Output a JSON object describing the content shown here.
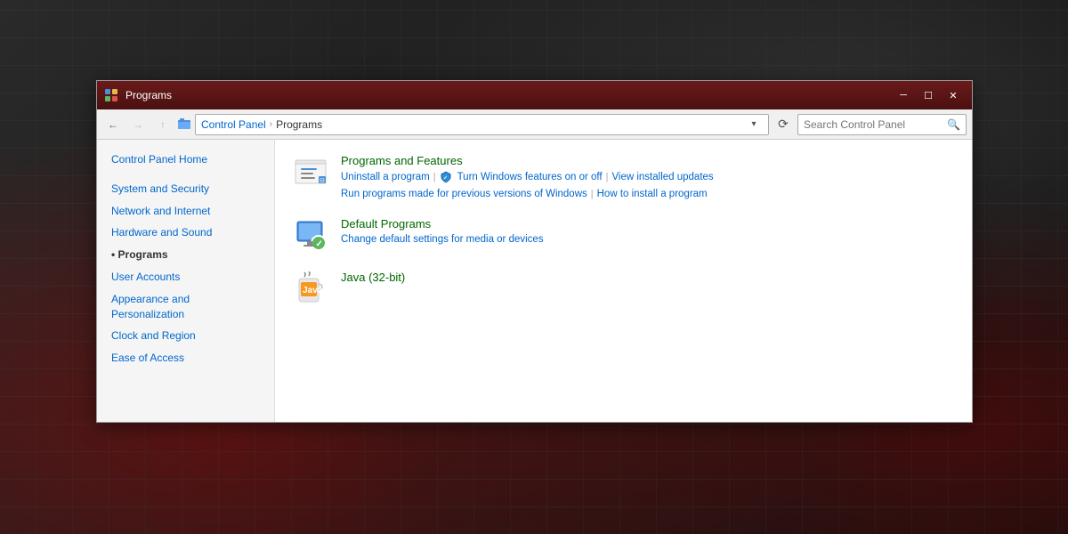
{
  "background": {
    "color": "#1a1a1a"
  },
  "window": {
    "title": "Programs",
    "icon": "programs-icon"
  },
  "titlebar": {
    "title": "Programs",
    "minimize_label": "─",
    "maximize_label": "☐",
    "close_label": "✕"
  },
  "addressbar": {
    "back_label": "←",
    "forward_label": "→",
    "up_label": "↑",
    "path_parts": [
      "Control Panel",
      "Programs"
    ],
    "search_placeholder": "Search Control Panel",
    "refresh_label": "⟳"
  },
  "sidebar": {
    "items": [
      {
        "label": "Control Panel Home",
        "id": "control-panel-home",
        "active": false
      },
      {
        "label": "System and Security",
        "id": "system-security",
        "active": false
      },
      {
        "label": "Network and Internet",
        "id": "network-internet",
        "active": false
      },
      {
        "label": "Hardware and Sound",
        "id": "hardware-sound",
        "active": false
      },
      {
        "label": "Programs",
        "id": "programs",
        "active": true
      },
      {
        "label": "User Accounts",
        "id": "user-accounts",
        "active": false
      },
      {
        "label": "Appearance and Personalization",
        "id": "appearance",
        "active": false
      },
      {
        "label": "Clock and Region",
        "id": "clock-region",
        "active": false
      },
      {
        "label": "Ease of Access",
        "id": "ease-access",
        "active": false
      }
    ]
  },
  "main": {
    "sections": [
      {
        "id": "programs-features",
        "title": "Programs and Features",
        "links": [
          {
            "label": "Uninstall a program",
            "id": "uninstall"
          },
          {
            "label": "Turn Windows features on or off",
            "id": "windows-features",
            "has_shield": true
          },
          {
            "label": "View installed updates",
            "id": "view-updates"
          },
          {
            "label": "Run programs made for previous versions of Windows",
            "id": "run-previous"
          },
          {
            "label": "How to install a program",
            "id": "how-install"
          }
        ]
      },
      {
        "id": "default-programs",
        "title": "Default Programs",
        "links": [
          {
            "label": "Change default settings for media or devices",
            "id": "change-defaults"
          }
        ]
      },
      {
        "id": "java",
        "title": "Java (32-bit)",
        "links": []
      }
    ]
  }
}
